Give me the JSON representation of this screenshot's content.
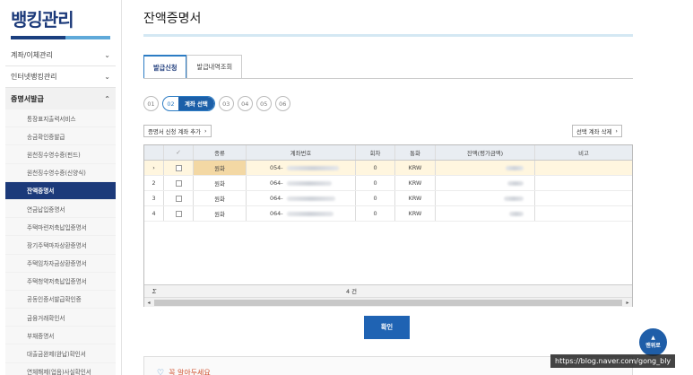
{
  "sidebar": {
    "brand": "뱅킹관리",
    "groups": [
      {
        "label": "계좌/이체관리",
        "chevron": "⌄"
      },
      {
        "label": "인터넷뱅킹관리",
        "chevron": "⌄"
      },
      {
        "label": "증명서발급",
        "chevron": "⌃"
      }
    ],
    "items": [
      {
        "label": "통장표지출력서비스"
      },
      {
        "label": "송금확인증발급"
      },
      {
        "label": "원천징수영수증(펀드)"
      },
      {
        "label": "원천징수영수증(신양식)"
      },
      {
        "label": "잔액증명서"
      },
      {
        "label": "연금납입증명서"
      },
      {
        "label": "주택마련저축납입증명서"
      },
      {
        "label": "장기주택마자상환증명서"
      },
      {
        "label": "주택임차자금상환증명서"
      },
      {
        "label": "주택청약저축납입증명서"
      },
      {
        "label": "공동인증서발급확인증"
      },
      {
        "label": "금융거래확인서"
      },
      {
        "label": "부채증명서"
      },
      {
        "label": "대출금완제(완납)확인서"
      },
      {
        "label": "연체해제(업음)사실확인서"
      }
    ]
  },
  "page": {
    "title": "잔액증명서"
  },
  "tabs": [
    {
      "label": "발급신청"
    },
    {
      "label": "발급내역조회"
    }
  ],
  "steps": [
    {
      "num": "01"
    },
    {
      "num": "02",
      "label": "계좌 선택"
    },
    {
      "num": "03"
    },
    {
      "num": "04"
    },
    {
      "num": "05"
    },
    {
      "num": "06"
    }
  ],
  "buttons": {
    "add_account": "증명서 신청 계좌 추가",
    "delete_selected": "선택 계좌 삭제",
    "arrow": "›",
    "confirm": "확인"
  },
  "table": {
    "headers": [
      "",
      "✓",
      "종류",
      "계좌번호",
      "회차",
      "통화",
      "잔액(평가금액)",
      "비고"
    ],
    "rows": [
      {
        "marker": "›",
        "num": "",
        "type": "원화",
        "account": "054-",
        "seq": "0",
        "currency": "KRW",
        "note": ""
      },
      {
        "marker": "",
        "num": "2",
        "type": "원화",
        "account": "064-",
        "seq": "0",
        "currency": "KRW",
        "note": ""
      },
      {
        "marker": "",
        "num": "3",
        "type": "원화",
        "account": "064-",
        "seq": "0",
        "currency": "KRW",
        "note": ""
      },
      {
        "marker": "",
        "num": "4",
        "type": "원화",
        "account": "064-",
        "seq": "0",
        "currency": "KRW",
        "note": ""
      }
    ],
    "footer_symbol": "Σ",
    "footer_count": "4 건",
    "scroll_left": "◂",
    "scroll_right": "▸"
  },
  "guide": {
    "label": "꼭 알아두세요",
    "icon": "lightbulb-icon"
  },
  "scroll_top": {
    "arrow": "▲",
    "label": "맨위로"
  },
  "watermark": "https://blog.naver.com/gong_bly"
}
